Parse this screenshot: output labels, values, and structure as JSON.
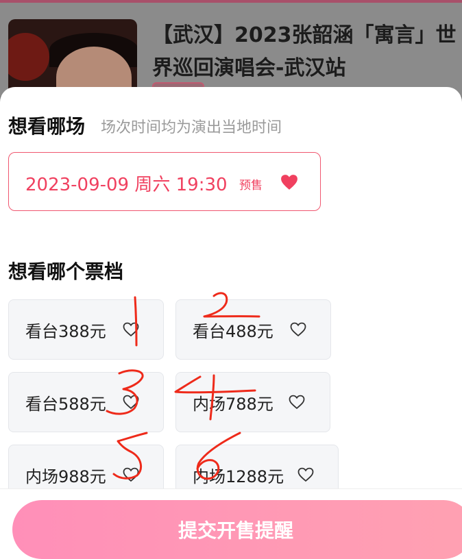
{
  "event": {
    "title": "【武汉】2023张韶涵「寓言」世界巡回演唱会-武汉站"
  },
  "session_section": {
    "title": "想看哪场",
    "subtitle": "场次时间均为演出当地时间",
    "session": {
      "datetime": "2023-09-09 周六 19:30",
      "badge": "预售"
    }
  },
  "tier_section": {
    "title": "想看哪个票档",
    "tiers": [
      {
        "label": "看台388元"
      },
      {
        "label": "看台488元"
      },
      {
        "label": "看台588元"
      },
      {
        "label": "内场788元"
      },
      {
        "label": "内场988元"
      },
      {
        "label": "内场1288元"
      }
    ]
  },
  "footer": {
    "submit_label": "提交开售提醒"
  },
  "colors": {
    "accent": "#f0405f",
    "button_gradient_start": "#ff8fb8",
    "button_gradient_end": "#ffa1b2",
    "annotation": "#ee2a1a"
  }
}
